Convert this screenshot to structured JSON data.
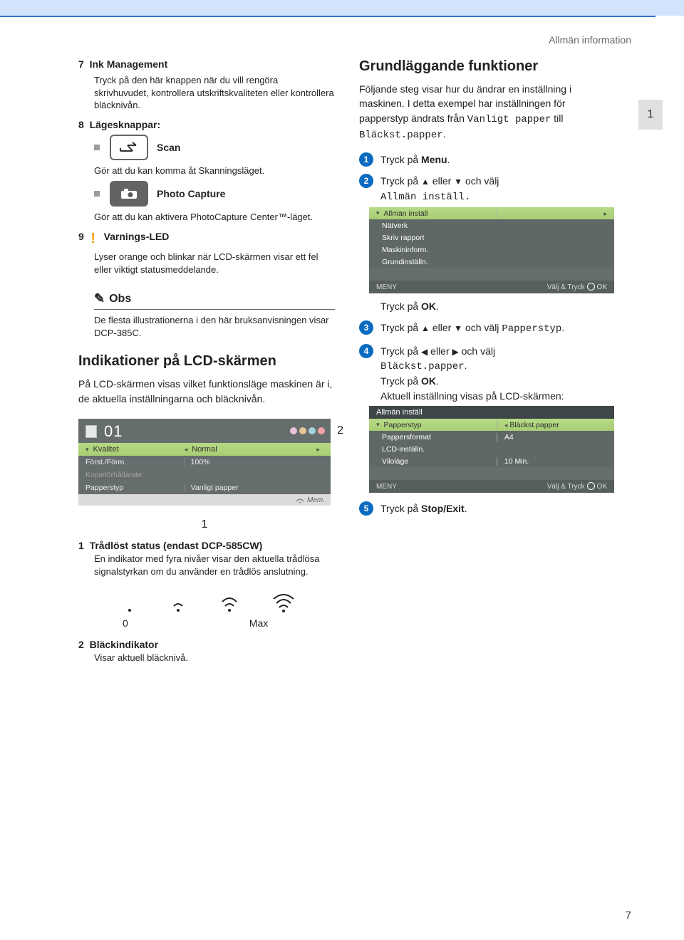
{
  "header": {
    "section": "Allmän information",
    "side_tab": "1",
    "page_number": "7"
  },
  "left": {
    "item7": {
      "num": "7",
      "title": "Ink Management",
      "desc": "Tryck på den här knappen när du vill rengöra skrivhuvudet, kontrollera utskriftskvaliteten eller kontrollera bläcknivån."
    },
    "item8": {
      "num": "8",
      "title": "Lägesknappar:",
      "scan_label": "Scan",
      "scan_desc": "Gör att du kan komma åt Skanningsläget.",
      "photo_label": "Photo Capture",
      "photo_desc": "Gör att du kan aktivera PhotoCapture Center™-läget."
    },
    "item9": {
      "num": "9",
      "title": "Varnings-LED",
      "desc": "Lyser orange och blinkar när LCD-skärmen visar ett fel eller viktigt statusmeddelande."
    },
    "note": {
      "title": "Obs",
      "body": "De flesta illustrationerna i den här bruksanvisningen visar DCP-385C."
    },
    "lcd_heading": "Indikationer på LCD-skärmen",
    "lcd_intro": "På LCD-skärmen visas vilket funktionsläge maskinen är i, de aktuella inställningarna och bläcknivån.",
    "lcd1": {
      "copies": "01",
      "row_sel": {
        "label": "Kvalitet",
        "value": "Normal"
      },
      "row_a": {
        "label": "Först./Förm.",
        "value": "100%"
      },
      "row_b": {
        "label": "Kopieförhållande:",
        "value": ""
      },
      "row_c": {
        "label": "Papperstyp",
        "value": "Vanligt papper"
      },
      "status": "Mem.",
      "callout_2": "2",
      "callout_1": "1"
    },
    "callouts": {
      "c1": {
        "num": "1",
        "title": "Trådlöst status (endast DCP-585CW)",
        "desc": "En indikator med fyra nivåer visar den aktuella trådlösa signalstyrkan om du använder en trådlös anslutning.",
        "low": "0",
        "high": "Max"
      },
      "c2": {
        "num": "2",
        "title": "Bläckindikator",
        "desc": "Visar aktuell bläcknivå."
      }
    }
  },
  "right": {
    "heading": "Grundläggande funktioner",
    "intro_a": "Följande steg visar hur du ändrar en inställning i maskinen. I detta exempel har inställningen för papperstyp ändrats från ",
    "intro_mono1": "Vanligt papper",
    "intro_mid": " till ",
    "intro_mono2": "Bläckst.papper",
    "intro_end": ".",
    "step1": {
      "pre": "Tryck på ",
      "bold": "Menu",
      "post": "."
    },
    "step2": {
      "pre": "Tryck på ",
      "up": "▲",
      "mid": " eller ",
      "down": "▼",
      "post": " och välj ",
      "mono": "Allmän inställ."
    },
    "lcd2a": {
      "hdr": "Allmän inställ",
      "rows": [
        "Nätverk",
        "Skriv rapport",
        "Maskininform.",
        "Grundinställn."
      ],
      "foot_left": "MENY",
      "foot_right_a": "Välj & Tryck",
      "foot_right_b": "OK"
    },
    "after2": {
      "pre": "Tryck på ",
      "bold": "OK",
      "post": "."
    },
    "step3": {
      "pre": "Tryck på ",
      "up": "▲",
      "mid": " eller ",
      "down": "▼",
      "post": " och välj ",
      "mono": "Papperstyp",
      "post2": "."
    },
    "step4": {
      "pre": "Tryck på ",
      "left": "◀",
      "mid": " eller ",
      "right": "▶",
      "post": " och välj ",
      "mono": "Bläckst.papper",
      "post2": ".",
      "line2a": "Tryck på ",
      "line2b": "OK",
      "line2c": ".",
      "line3": "Aktuell inställning visas på LCD-skärmen:"
    },
    "lcd2b": {
      "hdr": "Allmän inställ",
      "sel": {
        "label": "Papperstyp",
        "value": "Bläckst.papper"
      },
      "rows": [
        {
          "label": "Pappersformat",
          "value": "A4"
        },
        {
          "label": "LCD-inställn.",
          "value": ""
        },
        {
          "label": "Viloläge",
          "value": "10 Min."
        }
      ],
      "foot_left": "MENY",
      "foot_right_a": "Välj & Tryck",
      "foot_right_b": "OK"
    },
    "step5": {
      "pre": "Tryck på ",
      "bold": "Stop/Exit",
      "post": "."
    }
  }
}
